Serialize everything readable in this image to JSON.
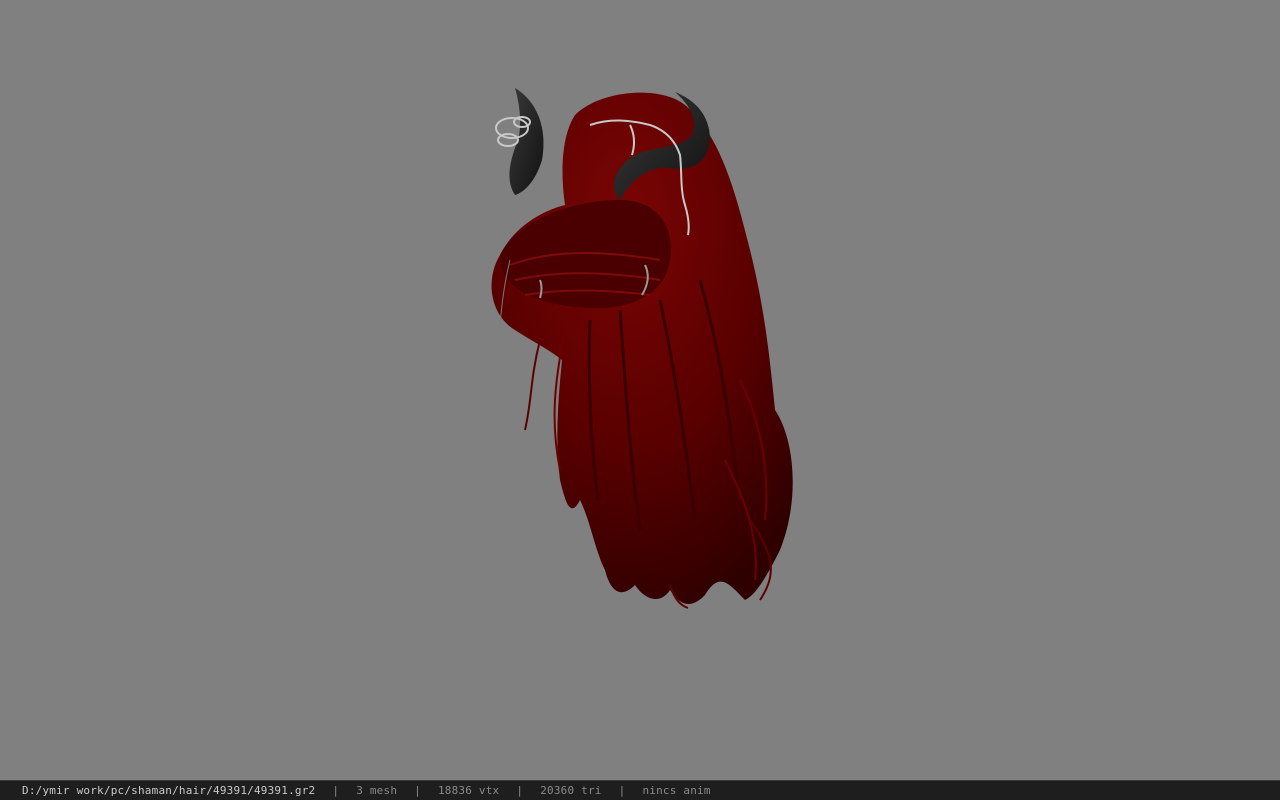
{
  "viewport": {
    "background_color": "#808080",
    "model": {
      "hair_color": "#5a0000",
      "horn_color": "#202020",
      "chain_color": "#c8c8c8"
    }
  },
  "statusbar": {
    "file_path": "D:/ymir work/pc/shaman/hair/49391/49391.gr2",
    "separator": "|",
    "mesh_count": "3 mesh",
    "vertex_count": "18836 vtx",
    "triangle_count": "20360 tri",
    "anim_status": "nincs anim"
  }
}
